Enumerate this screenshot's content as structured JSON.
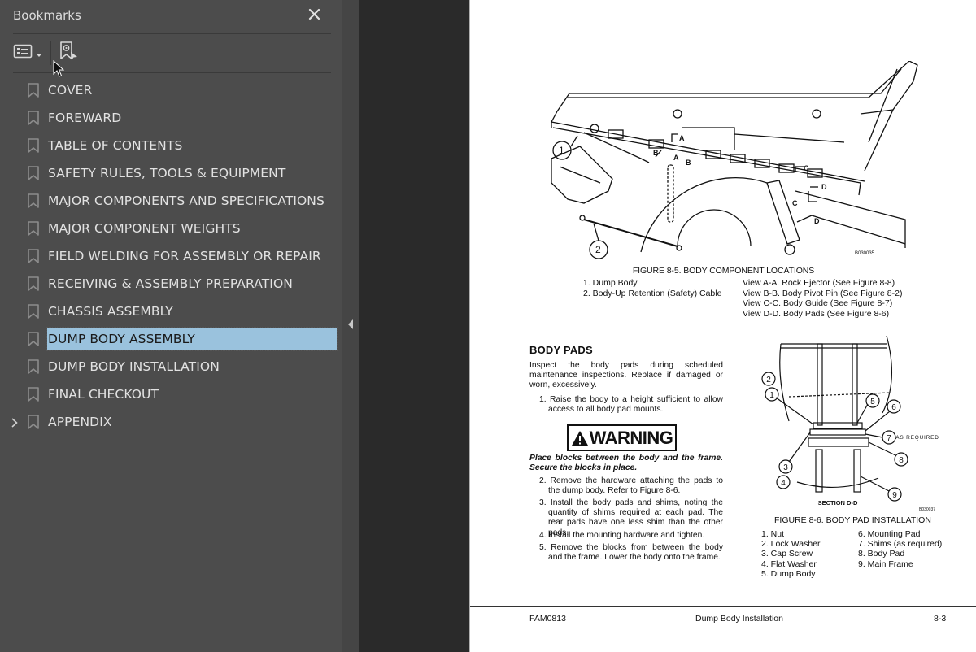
{
  "sidebar": {
    "title": "Bookmarks",
    "close_icon": "close-icon",
    "tools": {
      "options_icon": "list-options-icon",
      "find_icon": "find-current-bookmark-icon"
    },
    "items": [
      {
        "label": "COVER",
        "selected": false,
        "expandable": false
      },
      {
        "label": "FOREWARD",
        "selected": false,
        "expandable": false
      },
      {
        "label": "TABLE OF CONTENTS",
        "selected": false,
        "expandable": false
      },
      {
        "label": "SAFETY RULES, TOOLS & EQUIPMENT",
        "selected": false,
        "expandable": false
      },
      {
        "label": "MAJOR COMPONENTS AND SPECIFICATIONS",
        "selected": false,
        "expandable": false
      },
      {
        "label": "MAJOR COMPONENT WEIGHTS",
        "selected": false,
        "expandable": false
      },
      {
        "label": "FIELD WELDING FOR ASSEMBLY OR REPAIR",
        "selected": false,
        "expandable": false
      },
      {
        "label": "RECEIVING & ASSEMBLY PREPARATION",
        "selected": false,
        "expandable": false
      },
      {
        "label": "CHASSIS ASSEMBLY",
        "selected": false,
        "expandable": false
      },
      {
        "label": "DUMP BODY ASSEMBLY",
        "selected": true,
        "expandable": false
      },
      {
        "label": "DUMP BODY INSTALLATION",
        "selected": false,
        "expandable": false
      },
      {
        "label": "FINAL CHECKOUT",
        "selected": false,
        "expandable": false
      },
      {
        "label": "APPENDIX",
        "selected": false,
        "expandable": true
      }
    ]
  },
  "colors": {
    "sidebar_bg": "#4c4c4c",
    "selected_bg": "#9ac2dd",
    "viewer_bg": "#2a2a2a"
  },
  "page": {
    "figure1": {
      "callouts": [
        "1",
        "2"
      ],
      "section_marks": [
        "A",
        "A",
        "B",
        "B",
        "C",
        "C",
        "D",
        "D"
      ],
      "drawing_id": "B030035",
      "caption": "FIGURE 8-5. BODY COMPONENT LOCATIONS",
      "legend_left": [
        "1. Dump Body",
        "2. Body-Up Retention (Safety) Cable"
      ],
      "legend_right": [
        "View A-A. Rock Ejector (See Figure 8-8)",
        "View B-B. Body Pivot Pin (See Figure 8-2)",
        "View C-C. Body Guide (See Figure 8-7)",
        "View D-D. Body Pads (See Figure 8-6)"
      ]
    },
    "section_title": "BODY PADS",
    "intro": "Inspect the body pads during scheduled maintenance inspections. Replace if damaged or worn, excessively.",
    "step1": "1. Raise the body to a height sufficient to allow access to all body pad mounts.",
    "warning_label": "WARNING",
    "warning_text": "Place blocks between the body and the frame. Secure the blocks in place.",
    "steps": [
      "2. Remove the hardware attaching the pads to the dump body. Refer to Figure 8-6.",
      "3. Install the body pads and shims, noting the quantity of shims required at each pad. The rear pads have one less shim than the other pads.",
      "4. Install the mounting hardware and tighten.",
      "5. Remove the blocks from between the body and the frame. Lower the body onto the frame."
    ],
    "figure2": {
      "callouts": [
        "1",
        "2",
        "3",
        "4",
        "5",
        "6",
        "7",
        "8",
        "9"
      ],
      "as_required_label": "AS REQUIRED",
      "section_label": "SECTION D-D",
      "drawing_id": "B030037",
      "caption": "FIGURE 8-6. BODY PAD INSTALLATION",
      "legend_left": [
        "1. Nut",
        "2. Lock Washer",
        "3. Cap Screw",
        "4. Flat Washer",
        "5. Dump Body"
      ],
      "legend_right": [
        "6. Mounting Pad",
        "7. Shims (as required)",
        "8. Body Pad",
        "9. Main Frame"
      ]
    },
    "footer": {
      "doc_id": "FAM0813",
      "chapter": "Dump Body Installation",
      "page_number": "8-3"
    }
  }
}
